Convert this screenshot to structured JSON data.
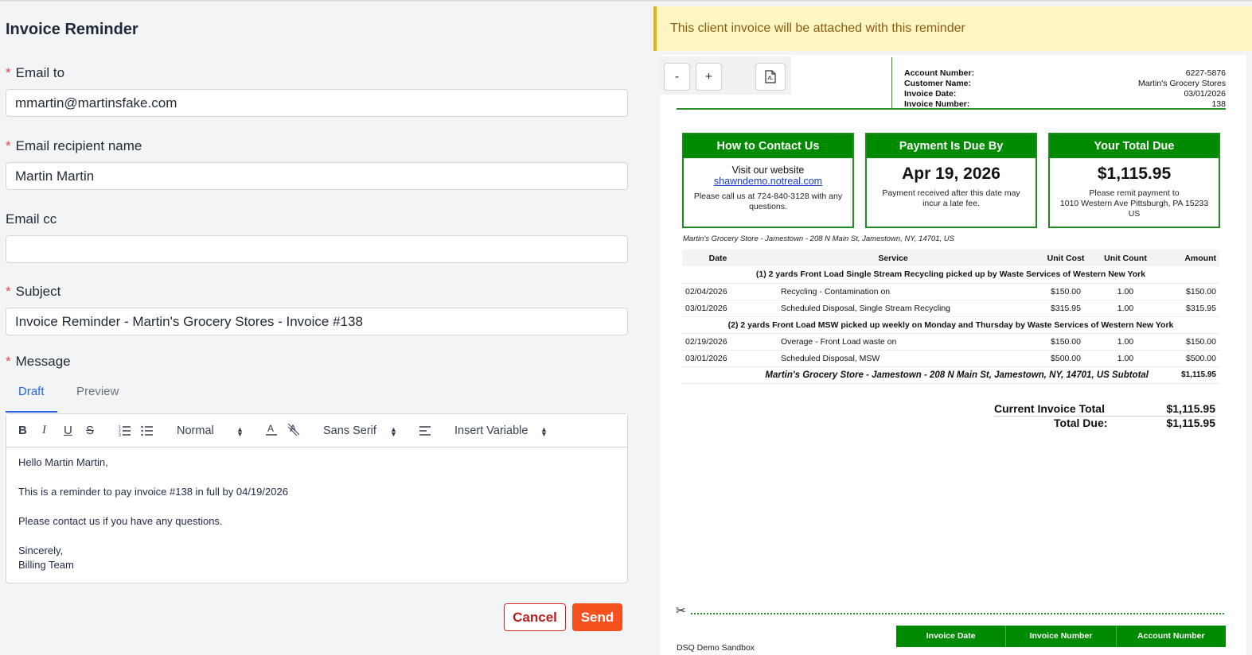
{
  "form": {
    "title": "Invoice Reminder",
    "email_to_label": "Email to",
    "email_to_value": "mmartin@martinsfake.com",
    "recipient_label": "Email recipient name",
    "recipient_value": "Martin Martin",
    "cc_label": "Email cc",
    "cc_value": "",
    "subject_label": "Subject",
    "subject_value": "Invoice Reminder - Martin's Grocery Stores - Invoice #138",
    "message_label": "Message",
    "required_marker": "*",
    "tabs": {
      "draft": "Draft",
      "preview": "Preview"
    },
    "toolbar": {
      "bold": "B",
      "italic": "I",
      "underline": "U",
      "strike": "S",
      "heading": "Normal",
      "font": "Sans Serif",
      "insert_variable": "Insert Variable"
    },
    "message_lines": [
      "Hello Martin Martin,",
      "This is a reminder to pay invoice #138 in full by 04/19/2026",
      "Please contact us if you have any questions.",
      "Sincerely,",
      "Billing Team"
    ],
    "cancel_label": "Cancel",
    "send_label": "Send"
  },
  "banner": {
    "text": "This client invoice will be attached with this reminder"
  },
  "viewer": {
    "zoom_out": "-",
    "zoom_in": "+"
  },
  "invoice": {
    "account": [
      {
        "key": "Account Number:",
        "value": "6227-5876"
      },
      {
        "key": "Customer Name:",
        "value": "Martin's Grocery Stores"
      },
      {
        "key": "Invoice Date:",
        "value": "03/01/2026"
      },
      {
        "key": "Invoice Number:",
        "value": "138"
      }
    ],
    "contact": {
      "heading": "How to Contact Us",
      "line1": "Visit our website",
      "link": "shawndemo.notreal.com",
      "line2": "Please call us at 724-840-3128 with any questions."
    },
    "due": {
      "heading": "Payment Is Due By",
      "date": "Apr 19, 2026",
      "note": "Payment received after this date may incur a late fee."
    },
    "total": {
      "heading": "Your Total Due",
      "amount": "$1,115.95",
      "note1": "Please remit payment to",
      "note2": "1010 Western Ave Pittsburgh, PA 15233",
      "note3": "US"
    },
    "location": "Martin's Grocery Store - Jamestown - 208 N Main St, Jamestown, NY, 14701, US",
    "columns": {
      "date": "Date",
      "service": "Service",
      "unit_cost": "Unit Cost",
      "unit_count": "Unit Count",
      "amount": "Amount"
    },
    "group1": "(1) 2 yards Front Load Single Stream Recycling picked up by Waste Services of Western New York",
    "group2": "(2) 2 yards Front Load MSW picked up weekly on Monday and Thursday by Waste Services of Western New York",
    "rows": [
      {
        "date": "02/04/2026",
        "service": "Recycling - Contamination on",
        "cost": "$150.00",
        "count": "1.00",
        "amount": "$150.00"
      },
      {
        "date": "03/01/2026",
        "service": "Scheduled Disposal, Single Stream Recycling",
        "cost": "$315.95",
        "count": "1.00",
        "amount": "$315.95"
      },
      {
        "date": "02/19/2026",
        "service": "Overage - Front Load waste on",
        "cost": "$150.00",
        "count": "1.00",
        "amount": "$150.00"
      },
      {
        "date": "03/01/2026",
        "service": "Scheduled Disposal, MSW",
        "cost": "$500.00",
        "count": "1.00",
        "amount": "$500.00"
      }
    ],
    "subtotal_label": "Martin's Grocery Store - Jamestown - 208 N Main St, Jamestown, NY, 14701, US Subtotal",
    "subtotal_value": "$1,115.95",
    "current_total_label": "Current Invoice Total",
    "current_total_value": "$1,115.95",
    "total_due_label": "Total Due:",
    "total_due_value": "$1,115.95",
    "footer_cols": [
      "Invoice Date",
      "Invoice Number",
      "Account Number"
    ],
    "company": "DSQ Demo Sandbox"
  },
  "colors": {
    "accent": "#2563eb",
    "send": "#f4511e",
    "invoice_green": "#008a00",
    "banner_bg": "#fdf6c3"
  }
}
